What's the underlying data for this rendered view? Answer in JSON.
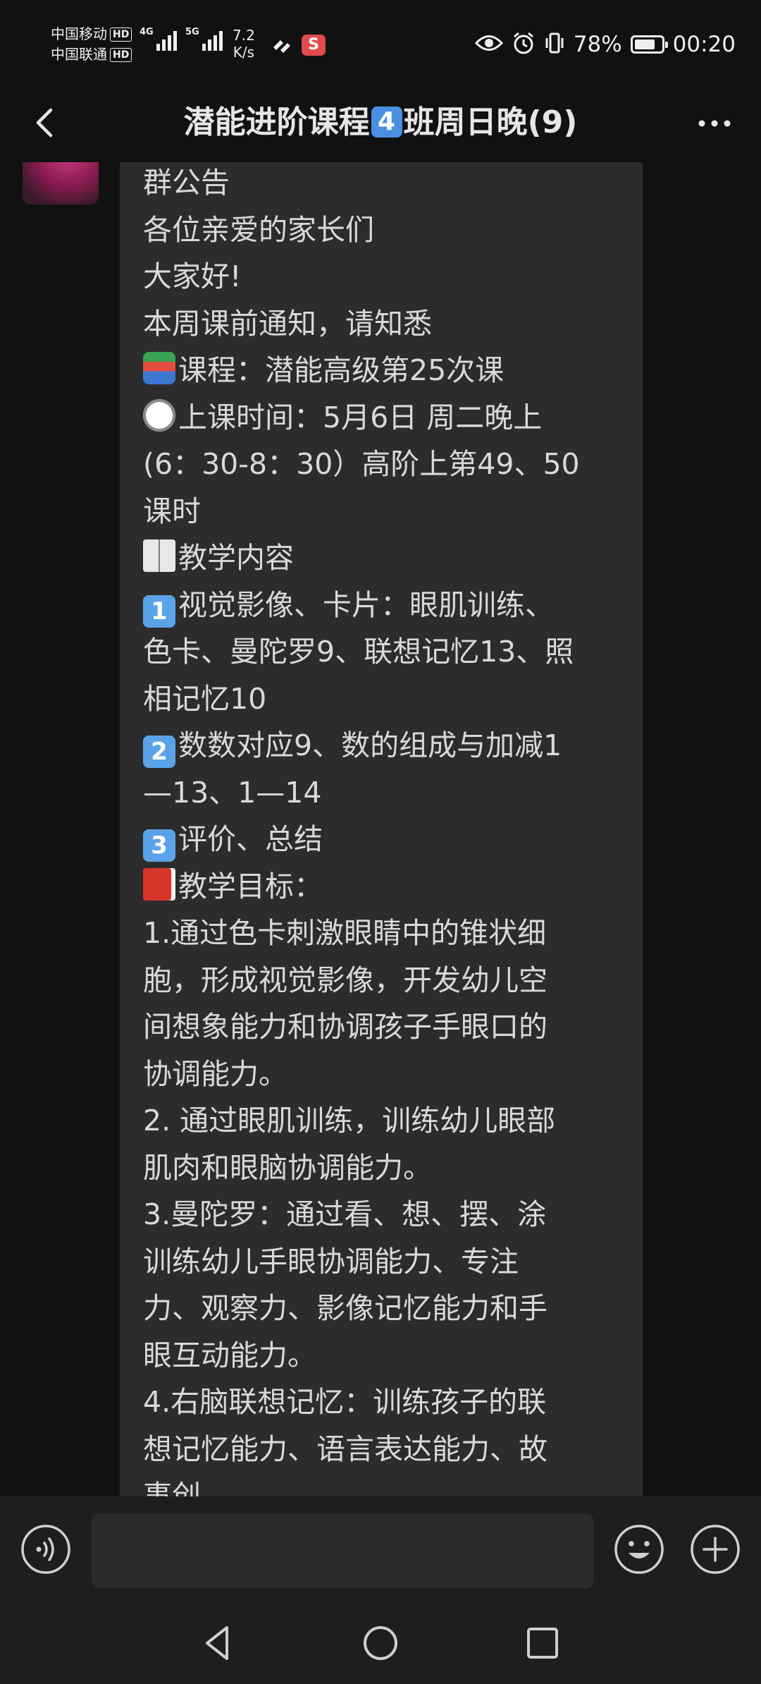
{
  "status_bar": {
    "carrier_1": "中国移动",
    "carrier_2": "中国联通",
    "hd_label": "HD",
    "network_1": "4G",
    "network_2": "5G",
    "speed_value": "7.2",
    "speed_unit": "K/s",
    "battery_percent": "78%",
    "battery_level": 0.78,
    "time": "00:20"
  },
  "header": {
    "title_prefix": "潜能进阶课程",
    "title_badge": "4",
    "title_suffix": "班周日晚(9)"
  },
  "message": {
    "lines": [
      "群公告",
      "各位亲爱的家长们",
      "大家好!",
      "本周课前通知，请知悉",
      "课程：潜能高级第25次课",
      "上课时间：5月6日 周二晚上",
      "(6：30-8：30）高阶上第49、50",
      "课时",
      "教学内容",
      "视觉影像、卡片：眼肌训练、",
      "色卡、曼陀罗9、联想记忆13、照",
      "相记忆10",
      "数数对应9、数的组成与加减1",
      "—13、1—14",
      "评价、总结",
      "教学目标：",
      "1.通过色卡刺激眼睛中的锥状细",
      "胞，形成视觉影像，开发幼儿空",
      "间想象能力和协调孩子手眼口的",
      "协调能力。",
      "2. 通过眼肌训练，训练幼儿眼部",
      "肌肉和眼脑协调能力。",
      "3.曼陀罗：通过看、想、摆、涂",
      "训练幼儿手眼协调能力、专注",
      "力、观察力、影像记忆能力和手",
      "眼互动能力。",
      "4.右脑联想记忆：训练孩子的联",
      "想记忆能力、语言表达能力、故",
      "事创"
    ],
    "keycaps": [
      "1",
      "2",
      "3"
    ]
  },
  "input_bar": {
    "placeholder": ""
  },
  "icons": {
    "back": "chevron-left-icon",
    "more": "more-dots-icon",
    "voice": "voice-icon",
    "emoji": "emoji-icon",
    "plus": "plus-icon"
  },
  "colors": {
    "background": "#111111",
    "bubble": "#2c2c2c",
    "text": "#d9d9d9",
    "badge_blue": "#4a90e2"
  }
}
